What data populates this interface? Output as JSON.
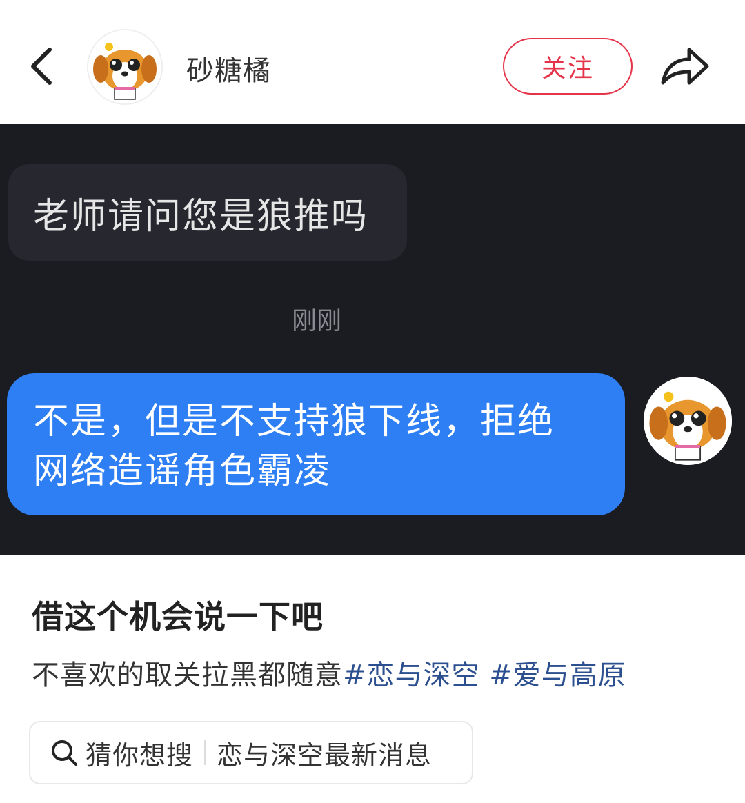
{
  "header": {
    "back_icon": "chevron-left-icon",
    "username": "砂糖橘",
    "follow_label": "关注",
    "share_icon": "share-arrow-icon",
    "accent_color": "#e5334a"
  },
  "chat": {
    "incoming_message": "老师请问您是狼推吗",
    "timestamp": "刚刚",
    "outgoing_lines": [
      "不是，但是不支持狼下线，拒绝",
      "网络造谣角色霸凌"
    ],
    "bubble_color": "#2d7ff3",
    "background_color": "#1b1b22"
  },
  "post": {
    "title": "借这个机会说一下吧",
    "body_text": "不喜欢的取关拉黑都随意",
    "tags": [
      "#恋与深空",
      "#爱与高原"
    ],
    "tag_color": "#2c4f8f"
  },
  "search": {
    "icon": "search-icon",
    "label": "猜你想搜",
    "suggestion": "恋与深空最新消息"
  }
}
